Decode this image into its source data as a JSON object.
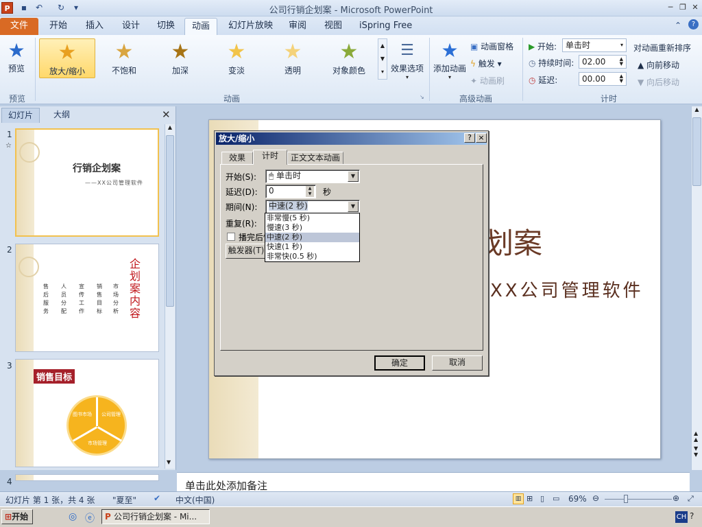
{
  "window": {
    "title": "公司行销企划案 - Microsoft PowerPoint",
    "app_icon": "P"
  },
  "tabs": [
    "文件",
    "开始",
    "插入",
    "设计",
    "切换",
    "动画",
    "幻灯片放映",
    "审阅",
    "视图",
    "iSpring Free"
  ],
  "ribbon": {
    "preview_label": "预览",
    "preview_group": "预览",
    "effects": [
      "放大/缩小",
      "不饱和",
      "加深",
      "变淡",
      "透明",
      "对象颜色"
    ],
    "effect_options": "效果选项",
    "animation_group": "动画",
    "add_animation": "添加动画",
    "animation_pane": "动画窗格",
    "trigger": "触发",
    "animation_painter": "动画刷",
    "advanced_group": "高级动画",
    "start_label": "开始:",
    "start_value": "单击时",
    "duration_label": "持续时间:",
    "duration_value": "02.00",
    "delay_label": "延迟:",
    "delay_value": "00.00",
    "timing_group": "计时",
    "reorder_title": "对动画重新排序",
    "move_earlier": "向前移动",
    "move_later": "向后移动"
  },
  "left_panel": {
    "tabs": [
      "幻灯片",
      "大纲"
    ],
    "slide_numbers": [
      "1",
      "2",
      "3",
      "4"
    ],
    "slide1_marker": "☆",
    "slide1_title": "行销企划案",
    "slide1_subtitle": "——XX公司管理软件",
    "slide2_title": "企划案内容",
    "slide2_items": [
      "售后服务",
      "人员分配",
      "宣传工作",
      "销售目标",
      "市场分析"
    ],
    "slide3_title": "销售目标",
    "slide3_segments": [
      "图书市场",
      "公司管理",
      "市场管理"
    ]
  },
  "slide": {
    "title_fragment": "划案",
    "subtitle_fragment": "XX公司管理软件"
  },
  "notes_placeholder": "单击此处添加备注",
  "dialog": {
    "title": "放大/缩小",
    "help": "?",
    "close": "×",
    "tabs": [
      "效果",
      "计时",
      "正文文本动画"
    ],
    "start_label": "开始(S):",
    "start_value": "单击时",
    "delay_label": "延迟(D):",
    "delay_value": "0",
    "delay_unit": "秒",
    "duration_label": "期间(N):",
    "duration_value": "中速(2 秒)",
    "repeat_label": "重复(R):",
    "rewind_label": "播完后快退",
    "trigger_button": "触发器(T)",
    "duration_options": [
      "非常慢(5 秒)",
      "慢速(3 秒)",
      "中速(2 秒)",
      "快速(1 秒)",
      "非常快(0.5 秒)"
    ],
    "ok": "确定",
    "cancel": "取消"
  },
  "status_bar": {
    "slide_info": "幻灯片 第 1 张，共 4 张",
    "theme": "\"夏至\"",
    "language": "中文(中国)",
    "zoom": "69%"
  },
  "taskbar": {
    "start": "开始",
    "task": "公司行销企划案 - Mi...",
    "ime": "CH"
  },
  "colors": {
    "file_tab": "#d96a24",
    "selection": "#ffd86a",
    "dialog_title": "#0a246a",
    "slide_accent": "#c0161b"
  },
  "icons": {
    "preview": "star-play-icon",
    "effect": "star-icon",
    "add_animation": "green-plus-star-icon"
  }
}
